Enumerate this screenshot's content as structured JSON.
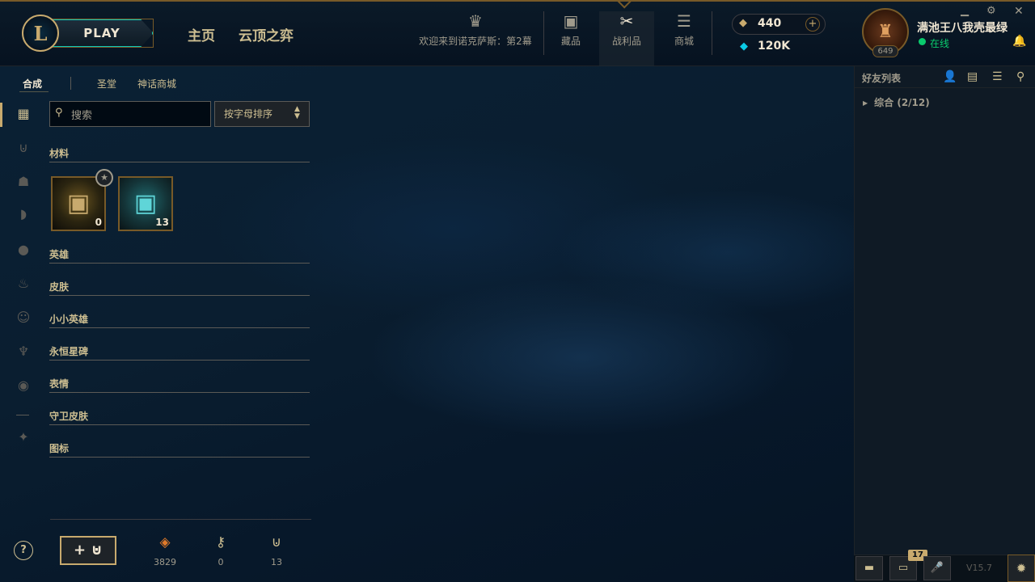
{
  "header": {
    "play_label": "PLAY",
    "nav": {
      "home": "主页",
      "tft": "云顶之弈"
    },
    "event_label": "欢迎来到诺克萨斯：第2幕",
    "collection_label": "藏品",
    "loot_label": "战利品",
    "store_label": "商城",
    "rp": "440",
    "be": "120K",
    "username": "满池王八我壳最绿",
    "status": "在线",
    "level": "649"
  },
  "loot_tabs": {
    "craft": "合成",
    "sanctum": "圣堂",
    "mythic": "神话商城"
  },
  "search": {
    "placeholder": "搜索"
  },
  "sort": {
    "label": "按字母排序"
  },
  "sections": {
    "materials": "材料",
    "champions": "英雄",
    "skins": "皮肤",
    "little_legends": "小小英雄",
    "eternals": "永恒星碑",
    "emotes": "表情",
    "ward_skins": "守卫皮肤",
    "icons": "图标"
  },
  "materials": [
    {
      "name": "hextech-chest",
      "count": "0"
    },
    {
      "name": "masterwork-chest",
      "count": "13"
    }
  ],
  "footer": {
    "open_label": "+",
    "essence": "3829",
    "keys": "0",
    "chests": "13"
  },
  "friends": {
    "title": "好友列表",
    "group_label": "综合 (2/12)",
    "notification_count": "17",
    "version": "V15.7"
  },
  "colors": {
    "gold": "#c8aa6e",
    "online": "#0acb6d",
    "blue_essence": "#0acbe6",
    "play_border": "#0ac8b9"
  }
}
